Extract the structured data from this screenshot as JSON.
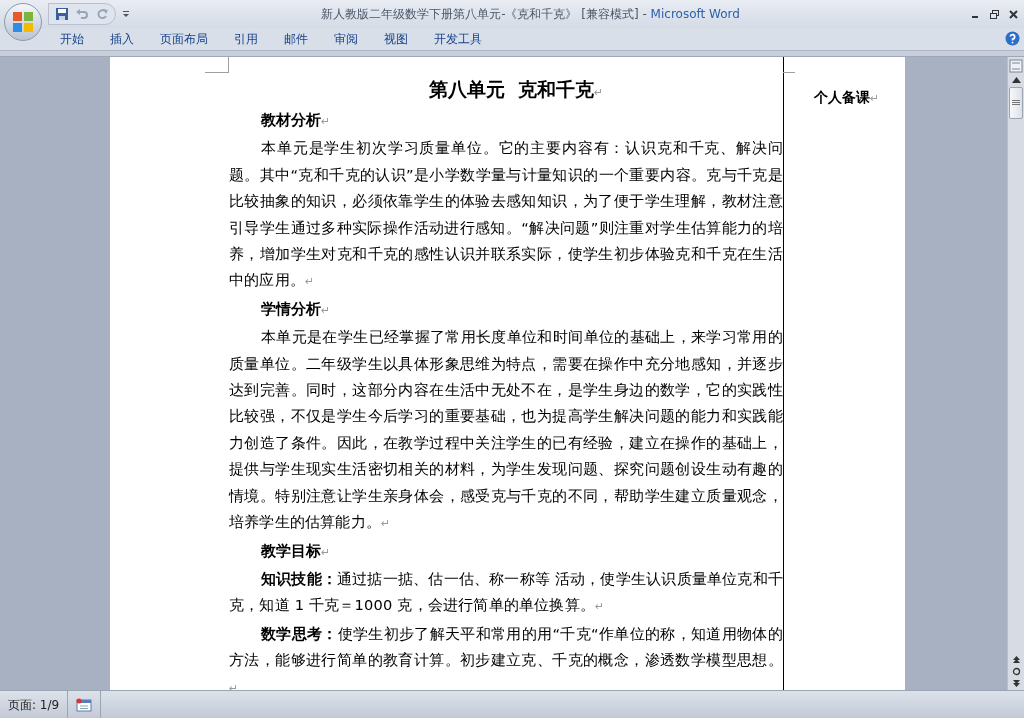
{
  "window": {
    "title": "新人教版二年级数学下册第八单元-《克和千克》 [兼容模式] - ",
    "app_name": "Microsoft Word"
  },
  "ribbon_tabs": [
    {
      "label": "开始",
      "selected": false
    },
    {
      "label": "插入",
      "selected": false
    },
    {
      "label": "页面布局",
      "selected": false
    },
    {
      "label": "引用",
      "selected": false
    },
    {
      "label": "邮件",
      "selected": false
    },
    {
      "label": "审阅",
      "selected": false
    },
    {
      "label": "视图",
      "selected": false
    },
    {
      "label": "开发工具",
      "selected": false
    }
  ],
  "document": {
    "title": "第八单元  克和千克",
    "title_mark": "↵",
    "side_note": "个人备课",
    "side_note_mark": "↵",
    "paragraphs": [
      {
        "kind": "heading",
        "text": "教材分析",
        "mark": "↵"
      },
      {
        "kind": "body",
        "text": "本单元是学生初次学习质量单位。它的主要内容有：认识克和千克、解决问题。其中“克和千克的认识”是小学数学量与计量知识的一个重要内容。克与千克是比较抽象的知识，必须依靠学生的体验去感知知识，为了便于学生理解，教材注意引导学生通过多种实际操作活动进行感知。“解决问题”则注重对学生估算能力的培养，增加学生对克和千克的感性认识并联系实际，使学生初步体验克和千克在生活中的应用。",
        "mark": "↵"
      },
      {
        "kind": "heading",
        "text": "学情分析",
        "mark": "↵"
      },
      {
        "kind": "body",
        "text": "本单元是在学生已经掌握了常用长度单位和时间单位的基础上，来学习常用的质量单位。二年级学生以具体形象思维为特点，需要在操作中充分地感知，并逐步达到完善。同时，这部分内容在生活中无处不在，是学生身边的数学，它的实践性比较强，不仅是学生今后学习的重要基础，也为提高学生解决问题的能力和实践能力创造了条件。因此，在教学过程中关注学生的已有经验，建立在操作的基础上，提供与学生现实生活密切相关的材料，为学生发现问题、探究问题创设生动有趣的情境。特别注意让学生亲身体会，感受克与千克的不同，帮助学生建立质量观念，培养学生的估算能力。",
        "mark": "↵"
      },
      {
        "kind": "heading",
        "text": "教学目标",
        "mark": "↵"
      },
      {
        "kind": "body",
        "text": "**知识技能：**通过掂一掂、估一估、称一称等 活动，使学生认识质量单位克和千克，知道 1 千克＝1000 克，会进行简单的单位换算。",
        "mark": "↵"
      },
      {
        "kind": "body",
        "text": "**数学思考：**使学生初步了解天平和常用的用“千克“作单位的称，知道用物体的方法，能够进行简单的教育计算。初步建立克、千克的概念，渗透数学模型思想。",
        "mark": "↵"
      }
    ]
  },
  "status_bar": {
    "page": "页面: 1/9"
  }
}
